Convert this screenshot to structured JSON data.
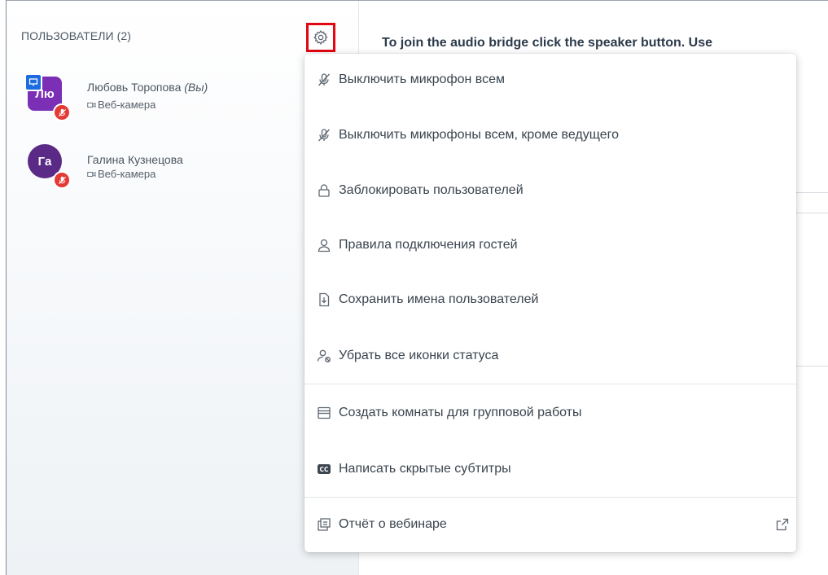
{
  "sidebar": {
    "title": "ПОЛЬЗОВАТЕЛИ (2)",
    "users": [
      {
        "initials": "Лю",
        "name": "Любовь Торопова",
        "you_tag": "(Вы)",
        "sub": "Веб-камера",
        "avatar_color": "#7b2fb5",
        "presenter": true,
        "muted": true
      },
      {
        "initials": "Га",
        "name": "Галина Кузнецова",
        "you_tag": "",
        "sub": "Веб-камера",
        "avatar_color": "#5b2a86",
        "presenter": false,
        "muted": true
      }
    ]
  },
  "main": {
    "banner": "To join the audio bridge click the speaker button. Use"
  },
  "menu": {
    "items": [
      {
        "label": "Выключить микрофон всем",
        "icon": "mic-off-icon"
      },
      {
        "label": "Выключить микрофоны всем, кроме ведущего",
        "icon": "mic-off-icon"
      },
      {
        "label": "Заблокировать пользователей",
        "icon": "lock-icon"
      },
      {
        "label": "Правила подключения гостей",
        "icon": "user-icon"
      },
      {
        "label": "Сохранить имена пользователей",
        "icon": "download-file-icon"
      },
      {
        "label": "Убрать все иконки статуса",
        "icon": "clear-status-icon"
      },
      {
        "label": "Создать комнаты для групповой работы",
        "icon": "rooms-icon"
      },
      {
        "label": "Написать скрытые субтитры",
        "icon": "closed-captions-icon"
      },
      {
        "label": "Отчёт о вебинаре",
        "icon": "report-icon",
        "external": true
      }
    ]
  },
  "colors": {
    "highlight": "#e30613",
    "presenter_badge": "#1c6be0",
    "mute_badge": "#e53935"
  }
}
